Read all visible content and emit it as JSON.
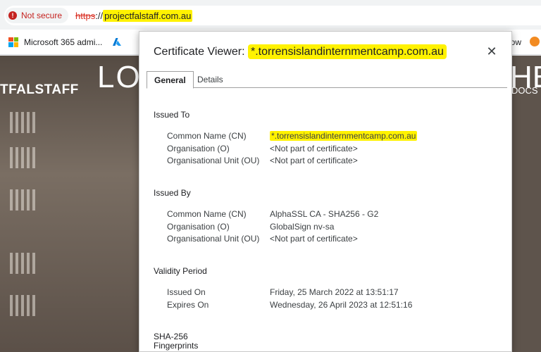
{
  "address_bar": {
    "security_label": "Not secure",
    "url_scheme": "https",
    "url_separator": "://",
    "url_host": "projectfalstaff.com.au"
  },
  "bookmarks": {
    "item1_label": "Microsoft 365 admi...",
    "right_label": "ow"
  },
  "site": {
    "brand": "TFALSTAFF",
    "title_left": "LO",
    "title_right": "HE",
    "docs": "DOCS"
  },
  "dialog": {
    "title_prefix": "Certificate Viewer: ",
    "title_cn": "*.torrensislandinternmentcamp.com.au",
    "close_glyph": "✕",
    "tabs": [
      {
        "label": "General"
      },
      {
        "label": "Details"
      }
    ],
    "issued_to": {
      "heading": "Issued To",
      "rows": [
        {
          "key": "Common Name (CN)",
          "value": "*.torrensislandinternmentcamp.com.au"
        },
        {
          "key": "Organisation (O)",
          "value": "<Not part of certificate>"
        },
        {
          "key": "Organisational Unit (OU)",
          "value": "<Not part of certificate>"
        }
      ]
    },
    "issued_by": {
      "heading": "Issued By",
      "rows": [
        {
          "key": "Common Name (CN)",
          "value": "AlphaSSL CA - SHA256 - G2"
        },
        {
          "key": "Organisation (O)",
          "value": "GlobalSign nv-sa"
        },
        {
          "key": "Organisational Unit (OU)",
          "value": "<Not part of certificate>"
        }
      ]
    },
    "validity": {
      "heading": "Validity Period",
      "rows": [
        {
          "key": "Issued On",
          "value": "Friday, 25 March 2022 at 13:51:17"
        },
        {
          "key": "Expires On",
          "value": "Wednesday, 26 April 2023 at 12:51:16"
        }
      ]
    },
    "fingerprints": {
      "heading_line1": "SHA-256",
      "heading_line2": "Fingerprints"
    }
  },
  "colors": {
    "warning": "#c5221f",
    "highlight": "#fff200"
  },
  "icons": [
    "warning-icon",
    "microsoft-logo-icon",
    "azure-icon",
    "close-icon",
    "favicon-icon"
  ]
}
